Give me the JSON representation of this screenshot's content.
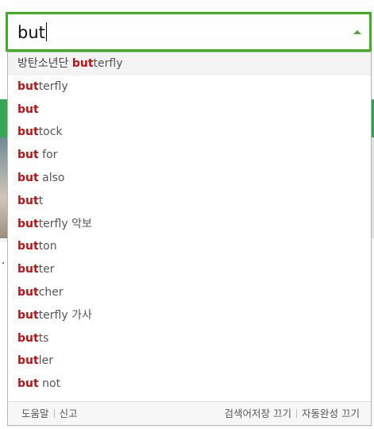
{
  "search": {
    "query": "but"
  },
  "colors": {
    "accent": "#3ab11e",
    "match": "#c01212"
  },
  "icons": {
    "toggle": "triangle-up-icon"
  },
  "suggestions": [
    {
      "pre": "방탄소년단 ",
      "match": "but",
      "rest": "terfly"
    },
    {
      "pre": "",
      "match": "but",
      "rest": "terfly"
    },
    {
      "pre": "",
      "match": "but",
      "rest": ""
    },
    {
      "pre": "",
      "match": "but",
      "rest": "tock"
    },
    {
      "pre": "",
      "match": "but",
      "rest": " for"
    },
    {
      "pre": "",
      "match": "but",
      "rest": " also"
    },
    {
      "pre": "",
      "match": "but",
      "rest": "t"
    },
    {
      "pre": "",
      "match": "but",
      "rest": "terfly 악보"
    },
    {
      "pre": "",
      "match": "but",
      "rest": "ton"
    },
    {
      "pre": "",
      "match": "but",
      "rest": "ter"
    },
    {
      "pre": "",
      "match": "but",
      "rest": "cher"
    },
    {
      "pre": "",
      "match": "but",
      "rest": "terfly 가사"
    },
    {
      "pre": "",
      "match": "but",
      "rest": "ts"
    },
    {
      "pre": "",
      "match": "but",
      "rest": "ler"
    },
    {
      "pre": "",
      "match": "but",
      "rest": " not"
    }
  ],
  "footer": {
    "help": "도움말",
    "report": "신고",
    "history_off": "검색어저장 끄기",
    "autocomplete_off": "자동완성 끄기"
  }
}
